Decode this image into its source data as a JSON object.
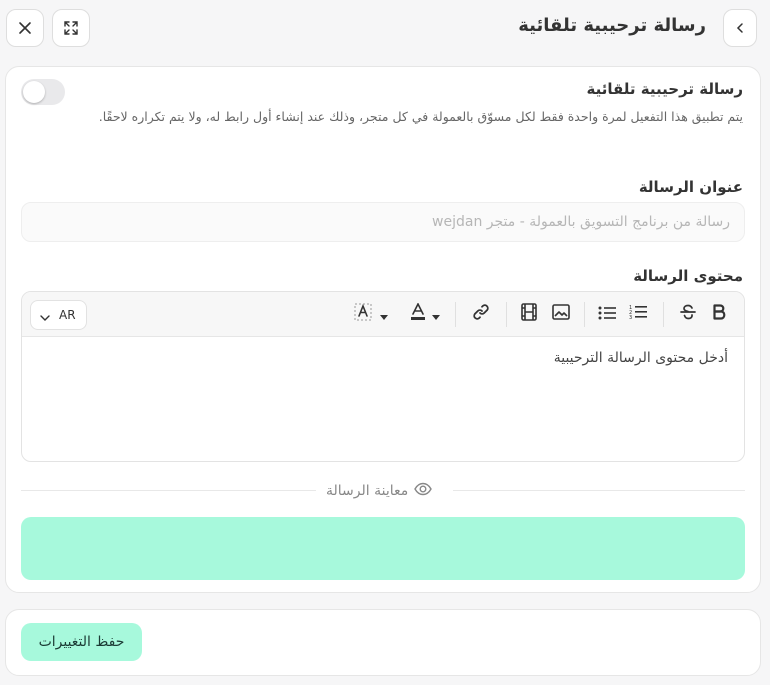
{
  "header": {
    "title": "رسالة ترحيبية تلقائية",
    "close_icon": "close-icon",
    "expand_icon": "expand-icon",
    "back_icon": "chevron-left-icon"
  },
  "auto_welcome": {
    "title": "رسالة ترحيبية تلقائية",
    "description": "يتم تطبيق هذا التفعيل لمرة واحدة فقط لكل مسوّق بالعمولة في كل متجر، وذلك عند إنشاء أول رابط له، ولا يتم تكراره لاحقًا.",
    "enabled": false
  },
  "message_title": {
    "label": "عنوان الرسالة",
    "value": "",
    "placeholder": "رسالة من برنامج التسويق بالعمولة - متجر wejdan"
  },
  "message_content": {
    "label": "محتوى الرسالة",
    "placeholder": "أدخل محتوى الرسالة الترحيبية",
    "language": "AR",
    "toolbar": [
      "bold",
      "strikethrough",
      "ordered-list",
      "bullet-list",
      "image",
      "video",
      "link",
      "text-color",
      "highlight-color"
    ]
  },
  "preview": {
    "label": "معاينة الرسالة",
    "bubble_color": "#a7f9dc"
  },
  "footer": {
    "save_label": "حفظ التغييرات"
  },
  "colors": {
    "accent": "#a7f9dc",
    "accent_text": "#1b3b35"
  }
}
